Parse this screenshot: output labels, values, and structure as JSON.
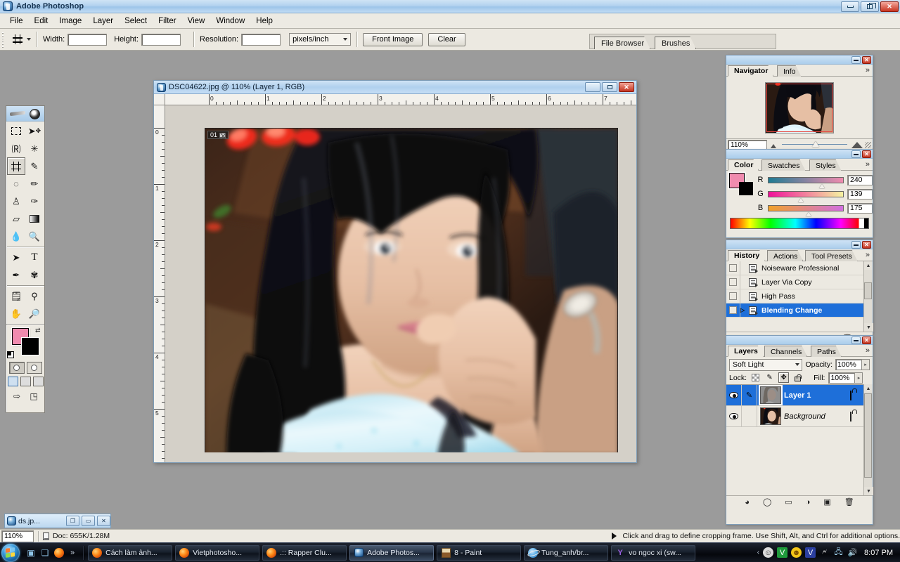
{
  "app": {
    "title": "Adobe Photoshop",
    "window_buttons": {
      "minimize": "minimize-icon",
      "restore": "restore-icon",
      "close": "close-icon"
    }
  },
  "menu": {
    "items": [
      "File",
      "Edit",
      "Image",
      "Layer",
      "Select",
      "Filter",
      "View",
      "Window",
      "Help"
    ]
  },
  "options_bar": {
    "tool": "crop-tool",
    "width_label": "Width:",
    "width_value": "",
    "height_label": "Height:",
    "height_value": "",
    "resolution_label": "Resolution:",
    "resolution_value": "",
    "units": "pixels/inch",
    "front_image_button": "Front Image",
    "clear_button": "Clear"
  },
  "palette_well": {
    "tabs": [
      "File Browser",
      "Brushes"
    ]
  },
  "toolbox": {
    "tools": [
      {
        "name": "marquee-tool",
        "glyph": "▭"
      },
      {
        "name": "move-tool",
        "glyph": "✥"
      },
      {
        "name": "lasso-tool",
        "glyph": "◌"
      },
      {
        "name": "magic-wand-tool",
        "glyph": "✳"
      },
      {
        "name": "crop-tool",
        "glyph": "⌗",
        "selected": true
      },
      {
        "name": "slice-tool",
        "glyph": "✂"
      },
      {
        "name": "healing-brush-tool",
        "glyph": "◍"
      },
      {
        "name": "brush-tool",
        "glyph": "✎"
      },
      {
        "name": "clone-stamp-tool",
        "glyph": "⚷"
      },
      {
        "name": "history-brush-tool",
        "glyph": "✑"
      },
      {
        "name": "eraser-tool",
        "glyph": "▱"
      },
      {
        "name": "gradient-tool",
        "glyph": "▤"
      },
      {
        "name": "blur-tool",
        "glyph": "💧"
      },
      {
        "name": "dodge-tool",
        "glyph": "🔍"
      },
      {
        "name": "path-selection-tool",
        "glyph": "➤"
      },
      {
        "name": "type-tool",
        "glyph": "T"
      },
      {
        "name": "pen-tool",
        "glyph": "✒"
      },
      {
        "name": "custom-shape-tool",
        "glyph": "✿"
      },
      {
        "name": "notes-tool",
        "glyph": "🗒"
      },
      {
        "name": "eyedropper-tool",
        "glyph": "⚲"
      },
      {
        "name": "hand-tool",
        "glyph": "✋"
      },
      {
        "name": "zoom-tool",
        "glyph": "🔎"
      }
    ],
    "foreground_color": "#f08baf",
    "background_color": "#000000"
  },
  "document": {
    "title": "DSC04622.jpg @ 110% (Layer 1, RGB)",
    "overlay_badge": "01",
    "ruler_h_labels": [
      "0",
      "1",
      "2",
      "3",
      "4",
      "5",
      "6",
      "7"
    ],
    "ruler_v_labels": [
      "0",
      "1",
      "2",
      "3",
      "4",
      "5"
    ],
    "window_buttons": {
      "minimize": "minimize-icon",
      "maximize": "maximize-icon",
      "close": "close-icon"
    }
  },
  "navigator": {
    "tabs": [
      "Navigator",
      "Info"
    ],
    "active_tab": "Navigator",
    "zoom_value": "110%"
  },
  "color": {
    "tabs": [
      "Color",
      "Swatches",
      "Styles"
    ],
    "active_tab": "Color",
    "channels": [
      {
        "label": "R",
        "value": "240"
      },
      {
        "label": "G",
        "value": "139"
      },
      {
        "label": "B",
        "value": "175"
      }
    ],
    "foreground_hex": "#f08baf",
    "background_hex": "#000000"
  },
  "history": {
    "tabs": [
      "History",
      "Actions",
      "Tool Presets"
    ],
    "active_tab": "History",
    "items": [
      {
        "label": "Noiseware Professional",
        "selected": false
      },
      {
        "label": "Layer Via Copy",
        "selected": false
      },
      {
        "label": "High Pass",
        "selected": false
      },
      {
        "label": "Blending Change",
        "selected": true
      }
    ],
    "footer_icons": [
      "new-document-icon",
      "new-snapshot-icon",
      "delete-icon"
    ]
  },
  "layers": {
    "tabs": [
      "Layers",
      "Channels",
      "Paths"
    ],
    "active_tab": "Layers",
    "blend_mode": "Soft Light",
    "opacity_label": "Opacity:",
    "opacity_value": "100%",
    "lock_label": "Lock:",
    "fill_label": "Fill:",
    "fill_value": "100%",
    "lock_icons": [
      "lock-transparency-icon",
      "lock-pixels-icon",
      "lock-position-icon",
      "lock-all-icon"
    ],
    "rows": [
      {
        "name": "Layer 1",
        "selected": true,
        "italic": false,
        "locked": true
      },
      {
        "name": "Background",
        "selected": false,
        "italic": true,
        "locked": true
      }
    ],
    "footer_icons": [
      "layer-style-icon",
      "layer-mask-icon",
      "layer-group-icon",
      "adjustment-layer-icon",
      "new-layer-icon",
      "delete-layer-icon"
    ]
  },
  "status_bar": {
    "zoom": "110%",
    "doc_size": "Doc: 655K/1.28M",
    "hint": "Click and drag to define cropping frame. Use Shift, Alt, and Ctrl for additional options."
  },
  "minimized_window": {
    "title": "ds.jp...",
    "buttons": [
      "restore-icon",
      "maximize-icon",
      "close-icon"
    ]
  },
  "taskbar": {
    "start_button": "start-orb",
    "quick_launch": [
      "show-desktop-icon",
      "switch-windows-icon",
      "firefox-icon"
    ],
    "overflow": "»",
    "buttons": [
      {
        "label": "Cách làm ảnh...",
        "icon": "firefox-icon",
        "active": false
      },
      {
        "label": "Vietphotosho...",
        "icon": "firefox-icon",
        "active": false
      },
      {
        "label": ".:: Rapper Clu...",
        "icon": "firefox-icon",
        "active": false
      },
      {
        "label": "Adobe Photos...",
        "icon": "photoshop-icon",
        "active": true
      },
      {
        "label": "8 - Paint",
        "icon": "paint-icon",
        "active": false
      },
      {
        "label": "Tung_anh/br...",
        "icon": "ie-icon",
        "active": false
      },
      {
        "label": "vo ngoc xi (sw...",
        "icon": "yahoo-icon",
        "active": false
      }
    ],
    "tray_icons": [
      "chevron-left-icon",
      "messenger-icon",
      "unikey-icon",
      "yahoo-smiley-icon",
      "antivirus-icon",
      "battery-icon",
      "network-icon",
      "volume-icon"
    ],
    "clock": "8:07 PM"
  }
}
